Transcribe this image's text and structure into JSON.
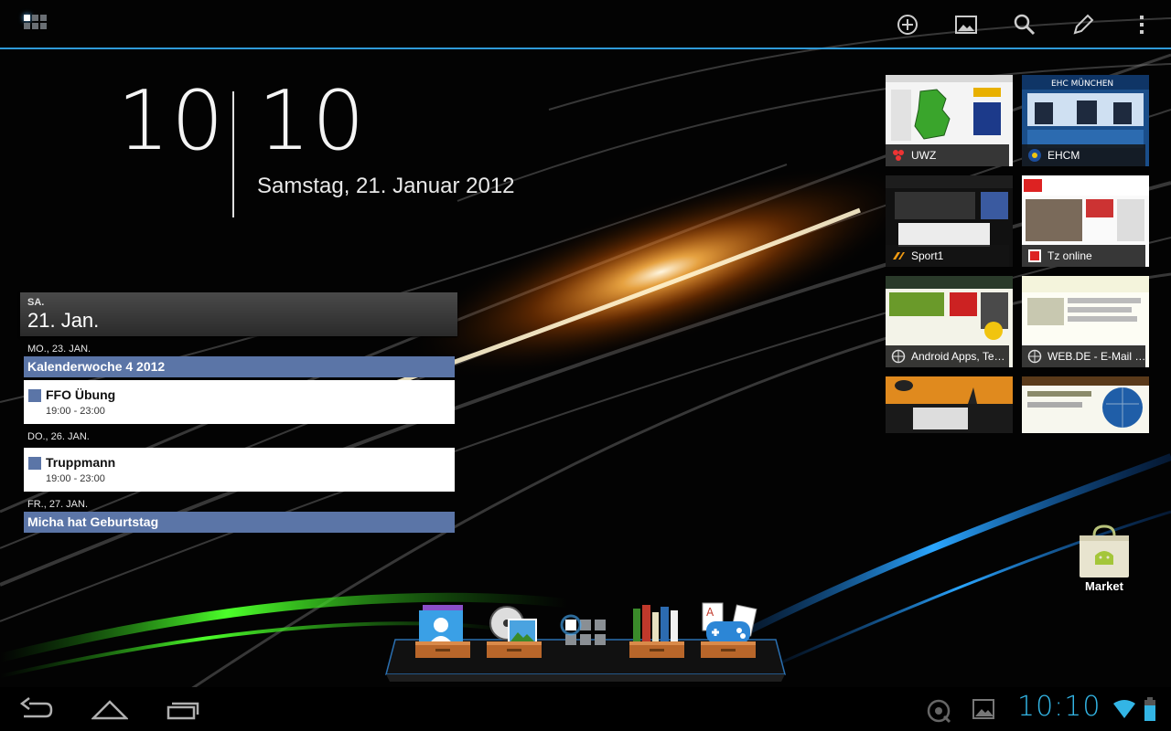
{
  "topbar": {
    "icons": [
      "apps-grid-icon",
      "add-icon",
      "wallpaper-icon",
      "search-icon",
      "edit-icon",
      "overflow-menu-icon"
    ]
  },
  "clock": {
    "hours": "10",
    "minutes": "10",
    "date": "Samstag, 21. Januar 2012"
  },
  "calendar": {
    "header_dow": "SA.",
    "header_day": "21. Jan.",
    "days": [
      {
        "label": "MO., 23. JAN.",
        "allday": "Kalenderwoche 4 2012",
        "events": [
          {
            "title": "FFO Übung",
            "time": "19:00 - 23:00"
          }
        ]
      },
      {
        "label": "DO., 26. JAN.",
        "allday": "",
        "events": [
          {
            "title": "Truppmann",
            "time": "19:00 - 23:00"
          }
        ]
      },
      {
        "label": "FR., 27. JAN.",
        "allday": "Micha hat Geburtstag",
        "events": []
      }
    ],
    "accent": "#5b75a7"
  },
  "bookmarks": [
    {
      "label": "UWZ"
    },
    {
      "label": "EHCM"
    },
    {
      "label": "Sport1"
    },
    {
      "label": "Tz online"
    },
    {
      "label": "Android Apps, Te…"
    },
    {
      "label": "WEB.DE - E-Mail …"
    },
    {
      "label": ""
    },
    {
      "label": ""
    }
  ],
  "market": {
    "label": "Market"
  },
  "dock": {
    "items": [
      "contacts-folder-icon",
      "media-folder-icon",
      "all-apps-icon",
      "books-folder-icon",
      "games-folder-icon"
    ]
  },
  "sysbar": {
    "time": "10:10",
    "accent": "#33b5e5"
  }
}
